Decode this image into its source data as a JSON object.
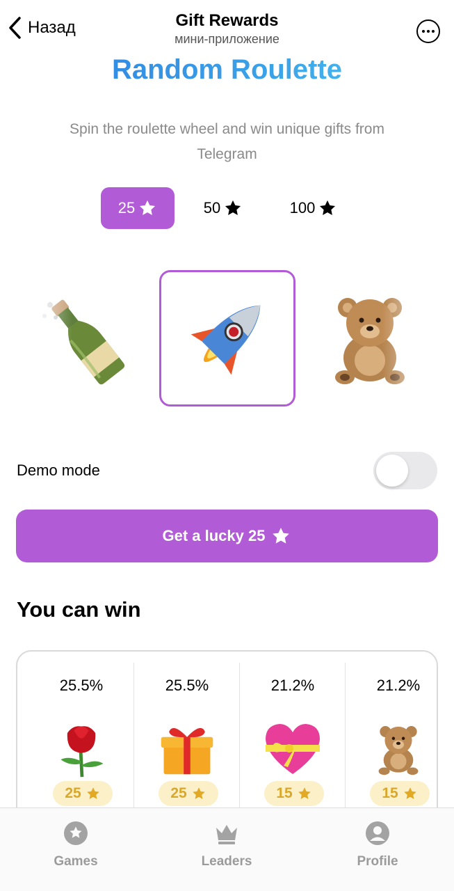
{
  "header": {
    "back_label": "Назад",
    "title": "Gift Rewards",
    "subtitle": "мини-приложение"
  },
  "hero": {
    "title": "Random Roulette",
    "description": "Spin the roulette wheel and win unique gifts from Telegram"
  },
  "bets": [
    {
      "label": "25",
      "selected": true
    },
    {
      "label": "50",
      "selected": false
    },
    {
      "label": "100",
      "selected": false
    }
  ],
  "roulette": {
    "items": [
      "champagne-bottle",
      "rocket",
      "teddy-bear"
    ],
    "selected": "rocket"
  },
  "demo": {
    "label": "Demo mode",
    "enabled": false
  },
  "cta": {
    "label": "Get a lucky 25"
  },
  "prizes_section": {
    "title": "You can win",
    "items": [
      {
        "chance": "25.5%",
        "icon": "rose",
        "price": "25"
      },
      {
        "chance": "25.5%",
        "icon": "gift-box",
        "price": "25"
      },
      {
        "chance": "21.2%",
        "icon": "heart-with-ribbon",
        "price": "15"
      },
      {
        "chance": "21.2%",
        "icon": "teddy-bear",
        "price": "15"
      }
    ]
  },
  "tabbar": {
    "games": "Games",
    "leaders": "Leaders",
    "profile": "Profile"
  },
  "colors": {
    "accent": "#b25bd6",
    "title_gradient_start": "#2f7ee0",
    "title_gradient_end": "#56c8f0",
    "price_bg": "#fbf0c8",
    "price_text": "#d9a82a",
    "muted": "#9b9b9b"
  }
}
